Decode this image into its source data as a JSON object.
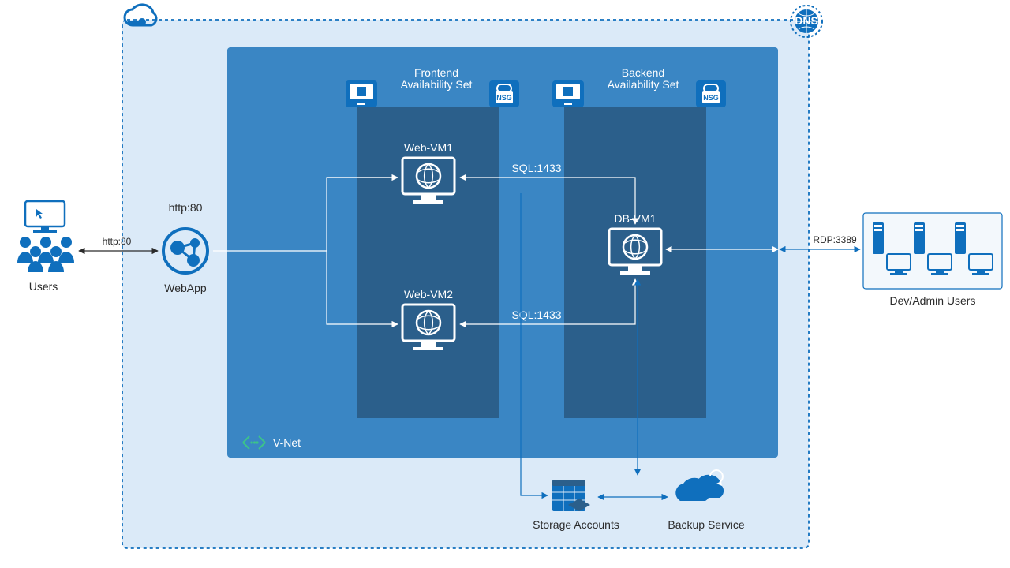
{
  "colors": {
    "azure": "#0f6fbd",
    "azure_light": "#dbeaf8",
    "vnet": "#3a86c4",
    "dark": "#2b5f8b",
    "accent": "#3cc38a"
  },
  "labels": {
    "users": "Users",
    "webapp": "WebApp",
    "http80_left": "http:80",
    "http80_right": "http:80",
    "vnet": "V-Net",
    "frontend_set": "Frontend\nAvailability Set",
    "backend_set": "Backend\nAvailability Set",
    "nsg": "NSG",
    "web_vm1": "Web-VM1",
    "web_vm2": "Web-VM2",
    "db_vm1": "DB-VM1",
    "sql_top": "SQL:1433",
    "sql_bot": "SQL:1433",
    "storage": "Storage Accounts",
    "backup": "Backup Service",
    "rdp": "RDP:3389",
    "dev_admin": "Dev/Admin Users",
    "dns": "DNS"
  }
}
